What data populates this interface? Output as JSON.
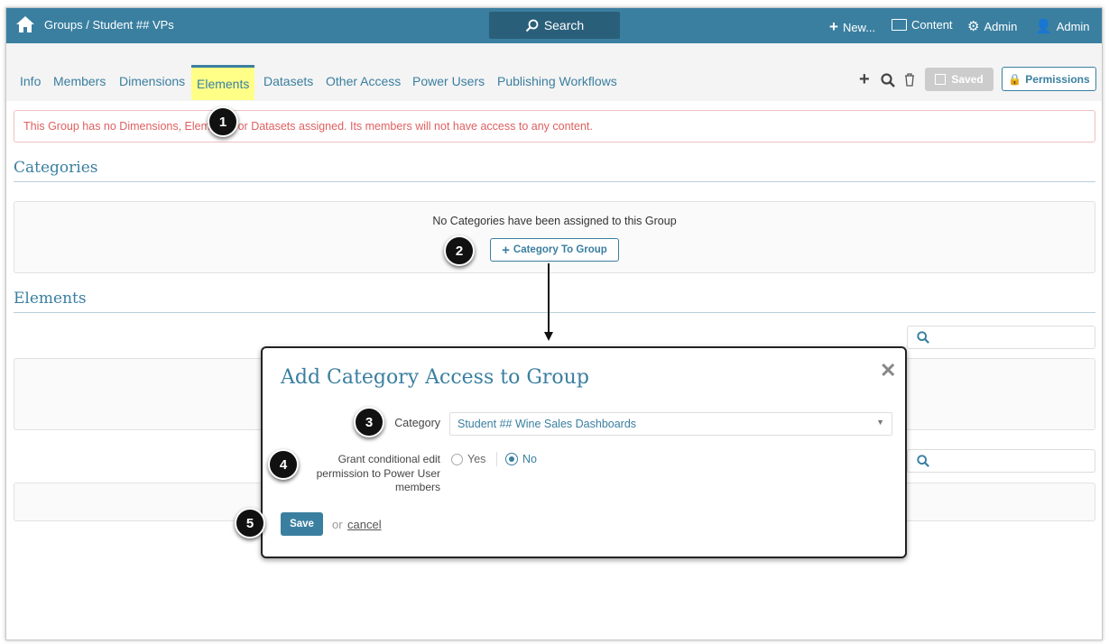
{
  "topbar": {
    "breadcrumb": "Groups / Student ## VPs",
    "search": "Search",
    "new": "New...",
    "content": "Content",
    "admin_settings": "Admin",
    "user": "Admin"
  },
  "tabs": [
    "Info",
    "Members",
    "Dimensions",
    "Elements",
    "Datasets",
    "Other Access",
    "Power Users",
    "Publishing Workflows"
  ],
  "toolbar": {
    "saved": "Saved",
    "permissions": "Permissions"
  },
  "alert": "This Group has no Dimensions, Elements, or Datasets assigned. Its members will not have access to any content.",
  "categories": {
    "heading": "Categories",
    "empty": "No Categories have been assigned to this Group",
    "add_button": "Category To Group"
  },
  "elements": {
    "heading": "Elements"
  },
  "modal": {
    "title": "Add Category Access to Group",
    "category_label": "Category",
    "category_value": "Student ## Wine Sales Dashboards",
    "grant_label": "Grant conditional edit permission to Power User members",
    "yes": "Yes",
    "no": "No",
    "selected": "No",
    "save": "Save",
    "or": "or",
    "cancel": "cancel"
  },
  "badges": [
    "1",
    "2",
    "3",
    "4",
    "5"
  ],
  "colors": {
    "brand": "#3a7fa0",
    "alert": "#e06060",
    "highlight": "#ffff88"
  }
}
